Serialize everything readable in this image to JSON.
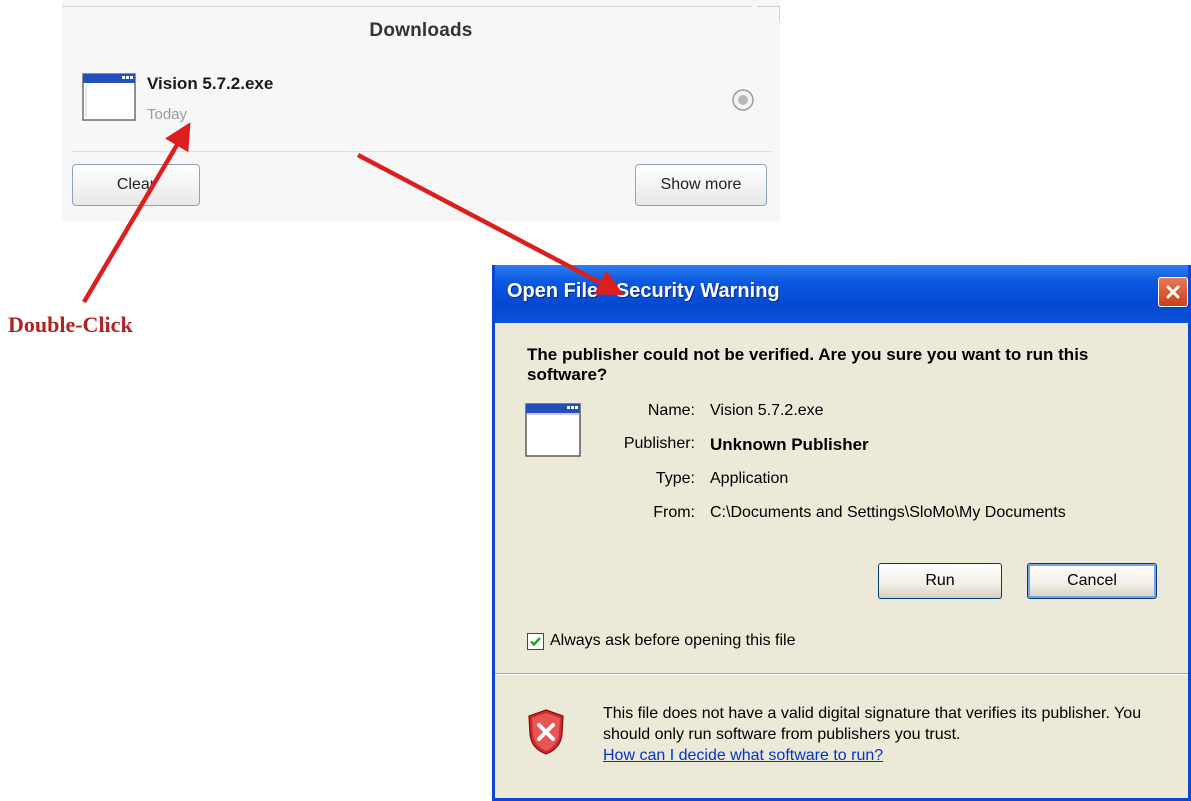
{
  "downloads": {
    "title": "Downloads",
    "item": {
      "filename": "Vision 5.7.2.exe",
      "date": "Today",
      "icon": "application-window-icon"
    },
    "clear_label": "Clear",
    "show_more_label": "Show more"
  },
  "annotation": {
    "label": "Double-Click",
    "color": "#cc1f1f"
  },
  "dialog": {
    "title": "Open File - Security Warning",
    "question": "The publisher could not be verified.  Are you sure you want to run this software?",
    "name_label": "Name:",
    "name_value": "Vision 5.7.2.exe",
    "publisher_label": "Publisher:",
    "publisher_value": "Unknown Publisher",
    "type_label": "Type:",
    "type_value": "Application",
    "from_label": "From:",
    "from_value": "C:\\Documents and Settings\\SloMo\\My Documents",
    "run_label": "Run",
    "cancel_label": "Cancel",
    "always_ask_label": "Always ask before opening this file",
    "always_ask_checked": true,
    "warning_text": "This file does not have a valid digital signature that verifies its publisher.  You should only run software from publishers you trust.",
    "help_link": "How can I decide what software to run?"
  },
  "colors": {
    "titlebar": "#0a57e0",
    "dialog_body": "#ece9d8",
    "close_button": "#d9542b",
    "link": "#0033cc"
  }
}
